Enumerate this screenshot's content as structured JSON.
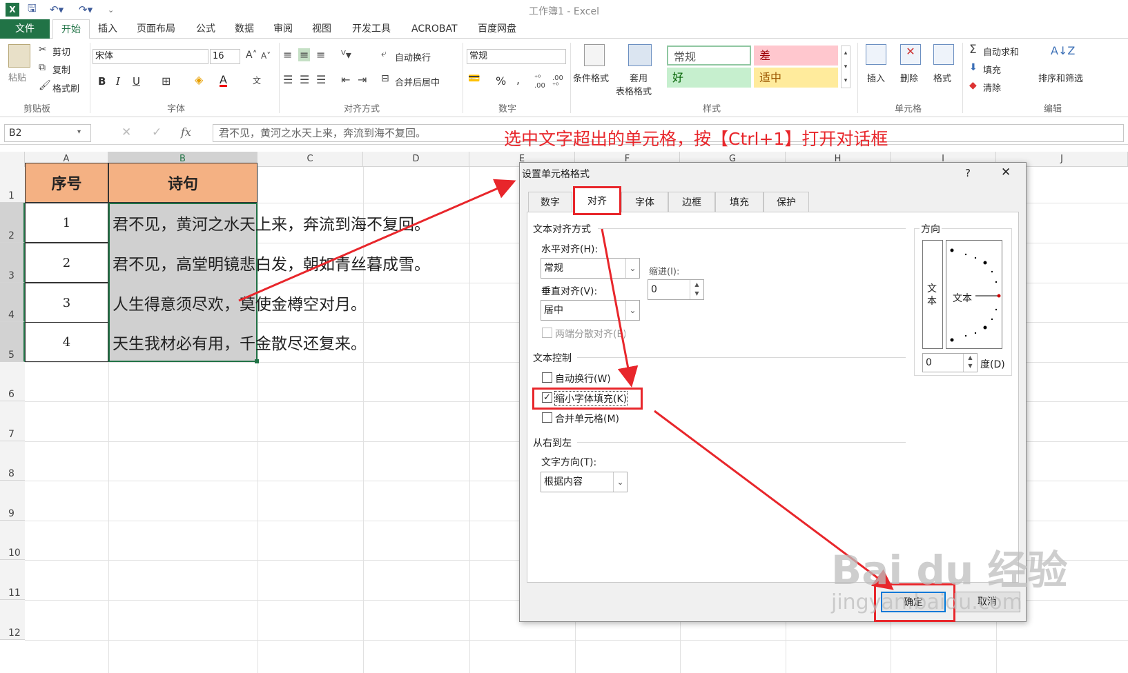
{
  "window": {
    "title": "工作簿1 - Excel"
  },
  "menu": {
    "file": "文件",
    "home": "开始",
    "insert": "插入",
    "layout": "页面布局",
    "formulas": "公式",
    "data": "数据",
    "review": "审阅",
    "view": "视图",
    "developer": "开发工具",
    "acrobat": "ACROBAT",
    "baidu": "百度网盘"
  },
  "ribbon": {
    "clipboard": {
      "paste": "粘贴",
      "cut": "剪切",
      "copy": "复制",
      "format_painter": "格式刷",
      "label": "剪贴板"
    },
    "font": {
      "name": "宋体",
      "size": "16",
      "bold": "B",
      "italic": "I",
      "underline": "U",
      "label": "字体"
    },
    "alignment": {
      "wrap": "自动换行",
      "merge": "合并后居中",
      "label": "对齐方式"
    },
    "number": {
      "format": "常规",
      "percent": "%",
      "label": "数字"
    },
    "styles": {
      "conditional": "条件格式",
      "table_format_1": "套用",
      "table_format_2": "表格格式",
      "normal": "常规",
      "bad": "差",
      "good": "好",
      "neutral": "适中",
      "label": "样式"
    },
    "cells": {
      "insert": "插入",
      "delete": "删除",
      "format": "格式",
      "label": "单元格"
    },
    "editing": {
      "autosum": "自动求和",
      "fill": "填充",
      "clear": "清除",
      "sort_filter": "排序和筛选",
      "label": "编辑"
    }
  },
  "formula_bar": {
    "name_box": "B2",
    "fx": "fx",
    "content": "君不见，黄河之水天上来，奔流到海不复回。"
  },
  "columns": [
    "A",
    "B",
    "C",
    "D",
    "E",
    "F",
    "G",
    "H",
    "I",
    "J"
  ],
  "rows": [
    "1",
    "2",
    "3",
    "4",
    "5",
    "6",
    "7",
    "8",
    "9",
    "10",
    "11",
    "12"
  ],
  "table": {
    "headers": [
      "序号",
      "诗句"
    ],
    "rows": [
      {
        "num": "1",
        "text": "君不见，黄河之水天上来，奔流到海不复回。"
      },
      {
        "num": "2",
        "text": "君不见，高堂明镜悲白发，朝如青丝暮成雪。"
      },
      {
        "num": "3",
        "text": "人生得意须尽欢，莫使金樽空对月。"
      },
      {
        "num": "4",
        "text": "天生我材必有用，千金散尽还复来。"
      }
    ]
  },
  "annotation": "选中文字超出的单元格，按【Ctrl+1】打开对话框",
  "dialog": {
    "title": "设置单元格格式",
    "help": "?",
    "close": "✕",
    "tabs": [
      "数字",
      "对齐",
      "字体",
      "边框",
      "填充",
      "保护"
    ],
    "text_alignment": "文本对齐方式",
    "horizontal_label": "水平对齐(H):",
    "horizontal_value": "常规",
    "indent_label": "缩进(I):",
    "indent_value": "0",
    "vertical_label": "垂直对齐(V):",
    "vertical_value": "居中",
    "justify_distributed": "两端分散对齐(E)",
    "text_control": "文本控制",
    "wrap_text": "自动换行(W)",
    "shrink_to_fit": "缩小字体填充(K)",
    "merge_cells": "合并单元格(M)",
    "rtl": "从右到左",
    "text_direction_label": "文字方向(T):",
    "text_direction_value": "根据内容",
    "orientation": "方向",
    "orientation_vertical_text": "文本",
    "orientation_text": "文本",
    "degrees_value": "0",
    "degrees_label": "度(D)",
    "ok": "确定",
    "cancel": "取消"
  },
  "watermark": {
    "logo": "Bai du 经验",
    "url": "jingyan.baidu.com"
  }
}
